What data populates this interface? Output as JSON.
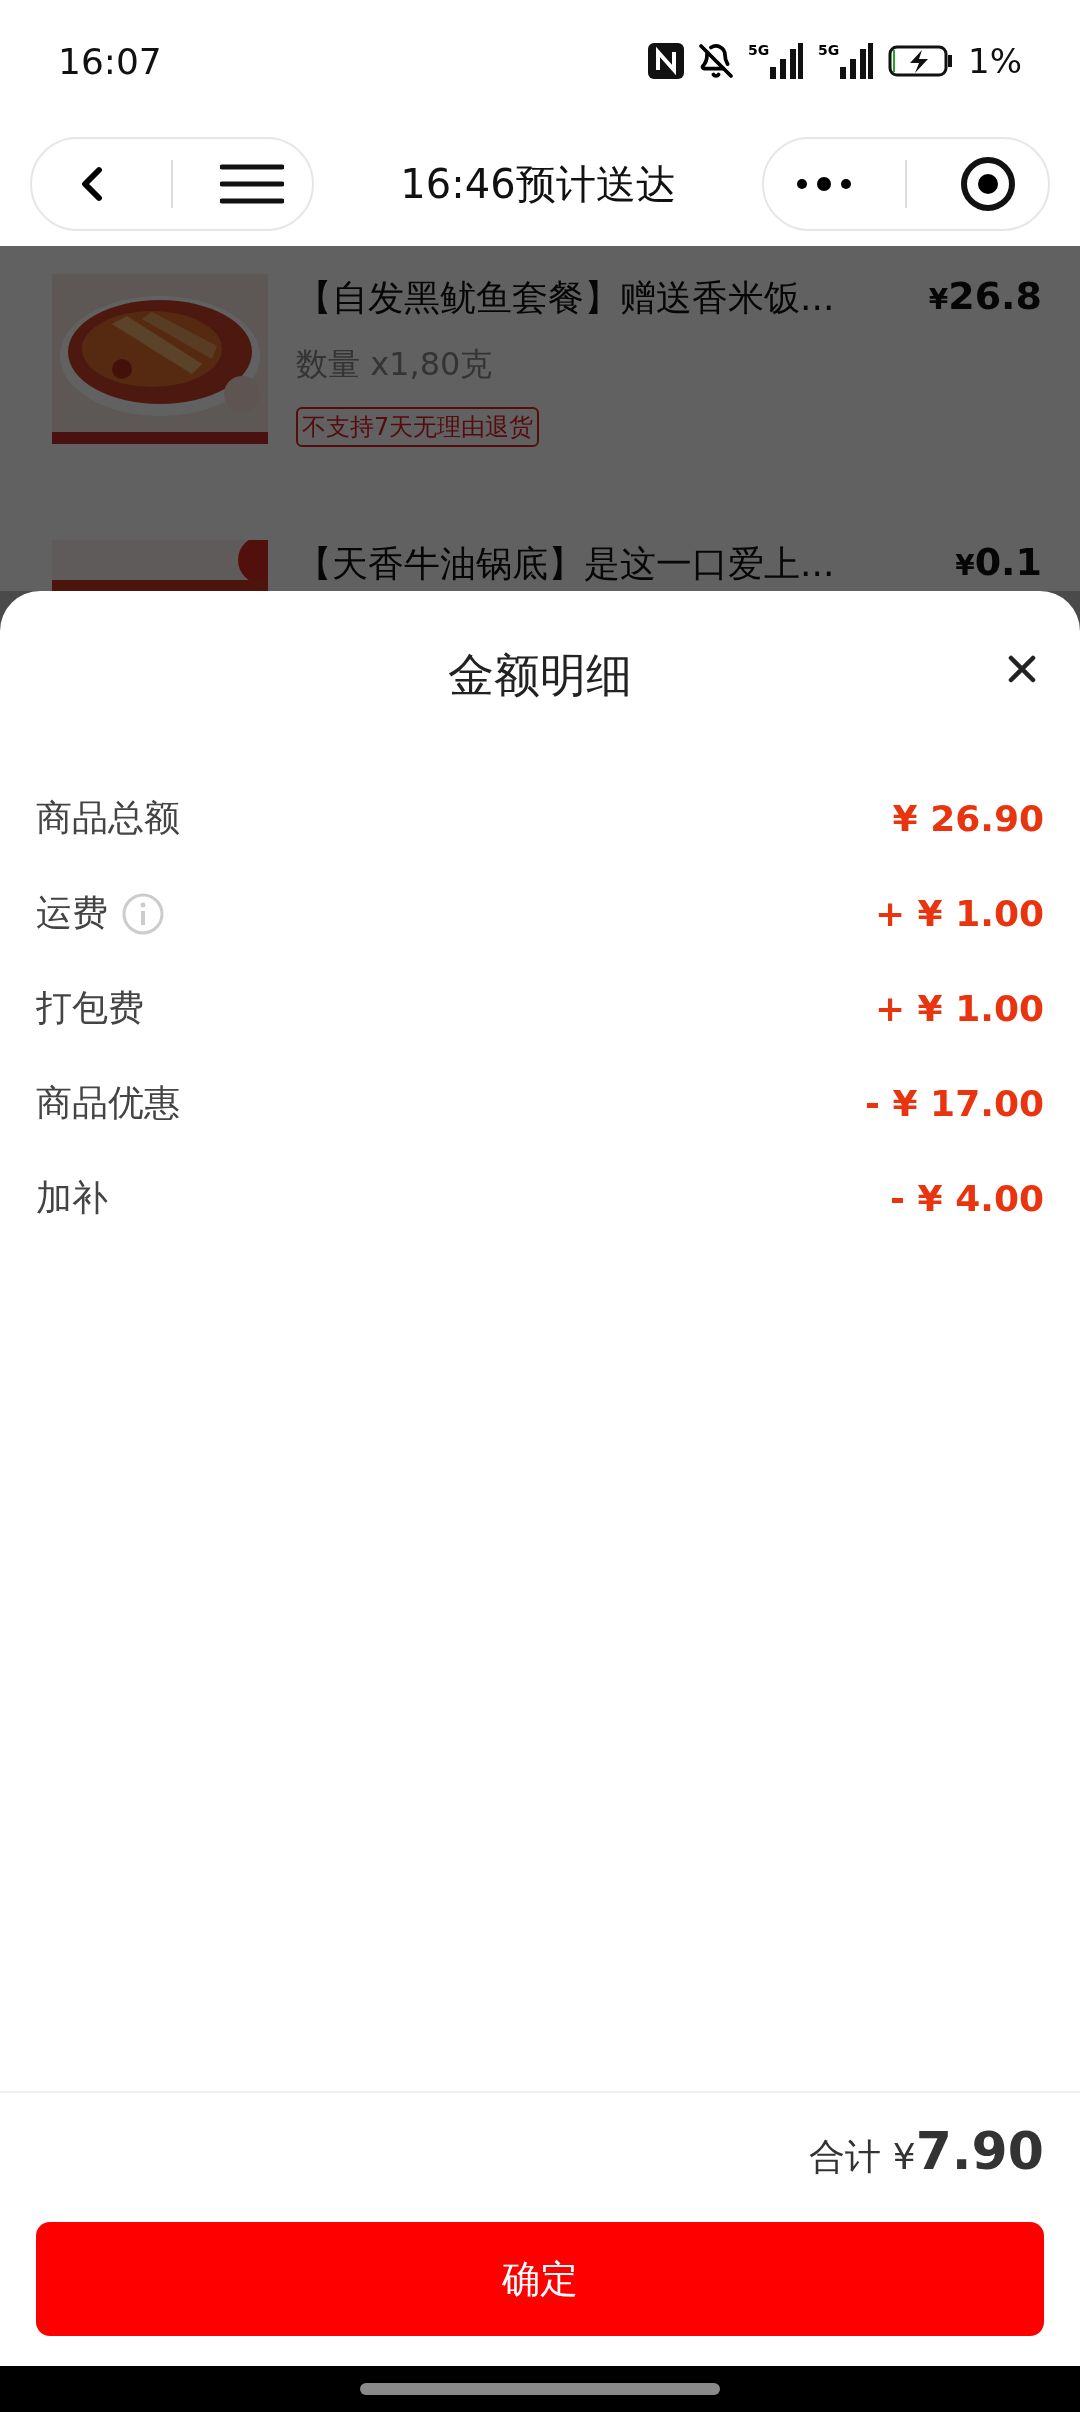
{
  "status_bar": {
    "time": "16:07",
    "network_1": "5G",
    "network_2": "5G",
    "battery": "1%"
  },
  "header": {
    "title": "16:46预计送达"
  },
  "products": [
    {
      "title": "【自发黑鱿鱼套餐】赠送香米饭...",
      "price_symbol": "¥",
      "price": "26.8",
      "quantity": "数量 x1,80克",
      "tag": "不支持7天无理由退货"
    },
    {
      "title": "【天香牛油锅底】是这一口爱上...",
      "price_symbol": "¥",
      "price": "0.1"
    }
  ],
  "sheet": {
    "title": "金额明细",
    "rows": [
      {
        "label": "商品总额",
        "value": "¥ 26.90",
        "info": false
      },
      {
        "label": "运费",
        "value": "+ ¥ 1.00",
        "info": true
      },
      {
        "label": "打包费",
        "value": "+ ¥ 1.00",
        "info": false
      },
      {
        "label": "商品优惠",
        "value": "- ¥ 17.00",
        "info": false
      },
      {
        "label": "加补",
        "value": "- ¥ 4.00",
        "info": false
      }
    ],
    "total": {
      "label": "合计",
      "symbol": "¥",
      "amount": "7.90"
    },
    "confirm": "确定"
  }
}
